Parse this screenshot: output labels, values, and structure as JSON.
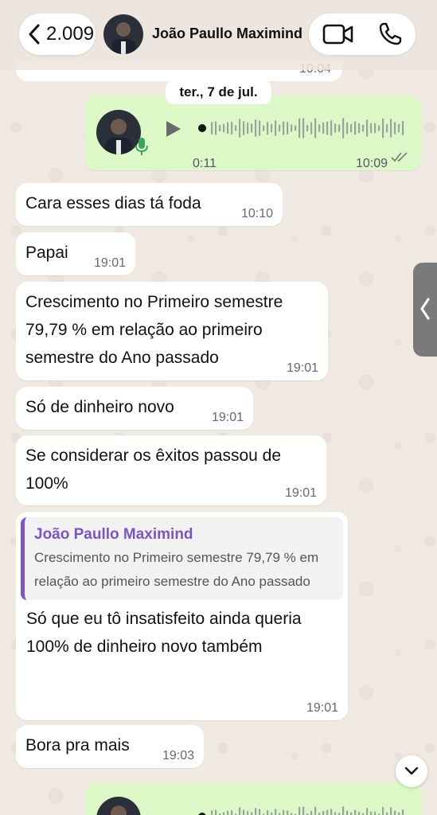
{
  "header": {
    "back_count": "2.009",
    "contact_name": "João Paullo Maximind"
  },
  "chat": {
    "partial_top_time": "10:04",
    "date_separator": "ter., 7 de jul.",
    "voice_message": {
      "duration": "0:11",
      "time": "10:09",
      "status": "read"
    },
    "messages": [
      {
        "text": "Cara esses dias tá foda",
        "time": "10:10"
      },
      {
        "text": "Papai",
        "time": "19:01"
      },
      {
        "text": "Crescimento no Primeiro semestre 79,79 % em relação ao primeiro semestre do Ano passado",
        "time": "19:01"
      },
      {
        "text": "Só de dinheiro novo",
        "time": "19:01"
      },
      {
        "text": "Se considerar os êxitos passou de 100%",
        "time": "19:01"
      },
      {
        "reply_author": "João Paullo Maximind",
        "reply_text": "Crescimento no Primeiro semestre 79,79 % em relação ao primeiro semestre do Ano passado",
        "text": "Só que eu tô insatisfeito ainda queria 100% de dinheiro novo também",
        "time": "19:01"
      },
      {
        "text": "Bora pra mais",
        "time": "19:03"
      }
    ]
  },
  "colors": {
    "outgoing_bubble": "#dbf8c6",
    "incoming_bubble": "#ffffff",
    "reply_accent": "#7b55c7",
    "background": "#efe9e1"
  },
  "icons": [
    "chevron-left-icon",
    "video-call-icon",
    "phone-icon",
    "play-icon",
    "mic-icon",
    "double-check-icon",
    "chevron-left-icon",
    "chevron-down-icon"
  ]
}
